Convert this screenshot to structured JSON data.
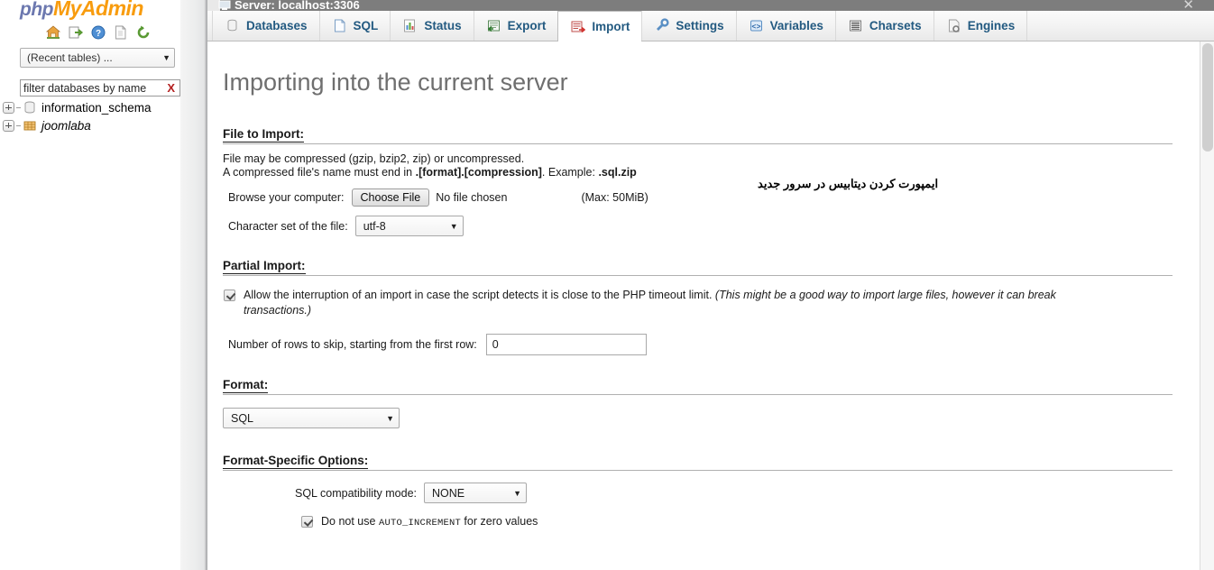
{
  "sidebar": {
    "logo": {
      "part1": "php",
      "part2": "MyAdmin"
    },
    "icons": [
      {
        "name": "home-icon",
        "title": "Home"
      },
      {
        "name": "logout-icon",
        "title": "Log out"
      },
      {
        "name": "help-icon",
        "title": "phpMyAdmin documentation"
      },
      {
        "name": "docs-icon",
        "title": "Documentation"
      },
      {
        "name": "reload-icon",
        "title": "Reload navigation"
      }
    ],
    "recent_select": {
      "value": "(Recent tables) ...",
      "arrow": "▼"
    },
    "filter": {
      "value": "filter databases by name",
      "clear": "X"
    },
    "databases": [
      {
        "label": "information_schema",
        "icon": "database-icon",
        "italic": false,
        "expander": "+"
      },
      {
        "label": "joomlaba",
        "icon": "database-table-icon",
        "italic": true,
        "expander": "+"
      }
    ]
  },
  "window": {
    "title": "Server: localhost:3306",
    "close_label": "✕",
    "monitor_icon": "server-icon"
  },
  "tabs": [
    {
      "label": "Databases",
      "icon": "databases-icon",
      "active": false
    },
    {
      "label": "SQL",
      "icon": "sql-icon",
      "active": false
    },
    {
      "label": "Status",
      "icon": "status-icon",
      "active": false
    },
    {
      "label": "Export",
      "icon": "export-icon",
      "active": false
    },
    {
      "label": "Import",
      "icon": "import-icon",
      "active": true
    },
    {
      "label": "Settings",
      "icon": "settings-icon",
      "active": false
    },
    {
      "label": "Variables",
      "icon": "variables-icon",
      "active": false
    },
    {
      "label": "Charsets",
      "icon": "charsets-icon",
      "active": false
    },
    {
      "label": "Engines",
      "icon": "engines-icon",
      "active": false
    }
  ],
  "page": {
    "title": "Importing into the current server",
    "annotation_fa": "ایمپورت کردن دیتابیس در سرور جدید"
  },
  "file_to_import": {
    "legend": "File to Import:",
    "desc_line1": "File may be compressed (gzip, bzip2, zip) or uncompressed.",
    "desc_line2_a": "A compressed file's name must end in ",
    "desc_line2_b": ".[format].[compression]",
    "desc_line2_c": ". Example: ",
    "desc_line2_d": ".sql.zip",
    "browse_label": "Browse your computer:",
    "choose_file_button": "Choose File",
    "no_file_text": "No file chosen",
    "max_size": "(Max: 50MiB)",
    "charset_label": "Character set of the file:",
    "charset_value": "utf-8",
    "arrow": "▼"
  },
  "partial_import": {
    "legend": "Partial Import:",
    "allow_interrupt_text": "Allow the interruption of an import in case the script detects it is close to the PHP timeout limit. ",
    "allow_interrupt_italic": "(This might be a good way to import large files, however it can break transactions.)",
    "allow_interrupt_checked": true,
    "skip_rows_label": "Number of rows to skip, starting from the first row:",
    "skip_rows_value": "0"
  },
  "format": {
    "legend": "Format:",
    "value": "SQL",
    "arrow": "▼"
  },
  "format_specific": {
    "legend": "Format-Specific Options:",
    "compat_label": "SQL compatibility mode:",
    "compat_value": "NONE",
    "arrow": "▼",
    "auto_increment_pre": "Do not use ",
    "auto_increment_mono": "AUTO_INCREMENT",
    "auto_increment_post": " for zero values",
    "auto_increment_checked": true
  },
  "colors": {
    "logo_php": "#6c78af",
    "logo_myadmin": "#f89c0e",
    "tab_text": "#235a81",
    "title_text": "#6f6f6f",
    "titlebar_bg": "#7d7d7d",
    "filter_clear": "#b32020"
  }
}
